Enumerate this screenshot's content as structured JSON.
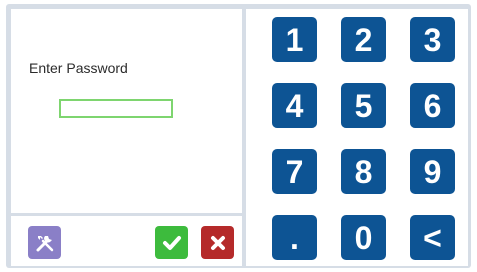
{
  "login": {
    "prompt": "Enter Password",
    "password_value": ""
  },
  "actions": {
    "tools_icon": "tools-icon",
    "confirm_icon": "checkmark-icon",
    "cancel_icon": "close-icon"
  },
  "keypad": {
    "keys": [
      "1",
      "2",
      "3",
      "4",
      "5",
      "6",
      "7",
      "8",
      "9",
      ".",
      "0",
      "<"
    ]
  },
  "colors": {
    "key_bg": "#0d5494",
    "field_border": "#7ed56f",
    "confirm": "#3dbb3d",
    "cancel": "#b52a2a",
    "tools": "#8a7fc7",
    "frame": "#d6dde6"
  }
}
